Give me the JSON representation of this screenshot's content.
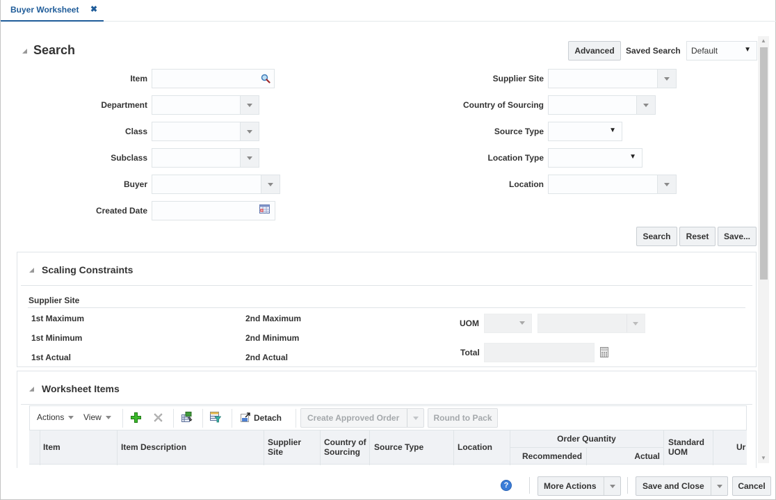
{
  "tab": {
    "title": "Buyer Worksheet",
    "close_glyph": "✖"
  },
  "search": {
    "title": "Search",
    "advanced_label": "Advanced",
    "saved_search_label": "Saved Search",
    "saved_search_value": "Default",
    "fields_left": [
      {
        "label": "Item",
        "value": ""
      },
      {
        "label": "Department",
        "value": ""
      },
      {
        "label": "Class",
        "value": ""
      },
      {
        "label": "Subclass",
        "value": ""
      },
      {
        "label": "Buyer",
        "value": ""
      },
      {
        "label": "Created Date",
        "value": ""
      }
    ],
    "fields_right": [
      {
        "label": "Supplier Site",
        "value": ""
      },
      {
        "label": "Country of Sourcing",
        "value": ""
      },
      {
        "label": "Source Type",
        "value": ""
      },
      {
        "label": "Location Type",
        "value": ""
      },
      {
        "label": "Location",
        "value": ""
      }
    ],
    "buttons": {
      "search": "Search",
      "reset": "Reset",
      "save": "Save..."
    }
  },
  "scaling": {
    "title": "Scaling Constraints",
    "supplier_site_label": "Supplier Site",
    "col1": [
      "1st Maximum",
      "1st Minimum",
      "1st Actual"
    ],
    "col2": [
      "2nd Maximum",
      "2nd Minimum",
      "2nd Actual"
    ],
    "uom_label": "UOM",
    "total_label": "Total"
  },
  "worksheet": {
    "title": "Worksheet Items",
    "toolbar": {
      "actions": "Actions",
      "view": "View",
      "detach": "Detach",
      "create_approved_order": "Create Approved Order",
      "round_to_pack": "Round to Pack"
    },
    "columns": {
      "item": "Item",
      "item_description": "Item Description",
      "supplier_site": [
        "Supplier",
        "Site"
      ],
      "country_of_sourcing": [
        "Country of",
        "Sourcing"
      ],
      "source_type": "Source Type",
      "location": "Location",
      "order_quantity": "Order Quantity",
      "recommended": "Recommended",
      "actual": "Actual",
      "standard_uom": [
        "Standard",
        "UOM"
      ],
      "unit_partial": "Ur"
    }
  },
  "footer": {
    "more_actions": "More Actions",
    "save_and_close": "Save and Close",
    "cancel": "Cancel",
    "help_glyph": "?"
  }
}
